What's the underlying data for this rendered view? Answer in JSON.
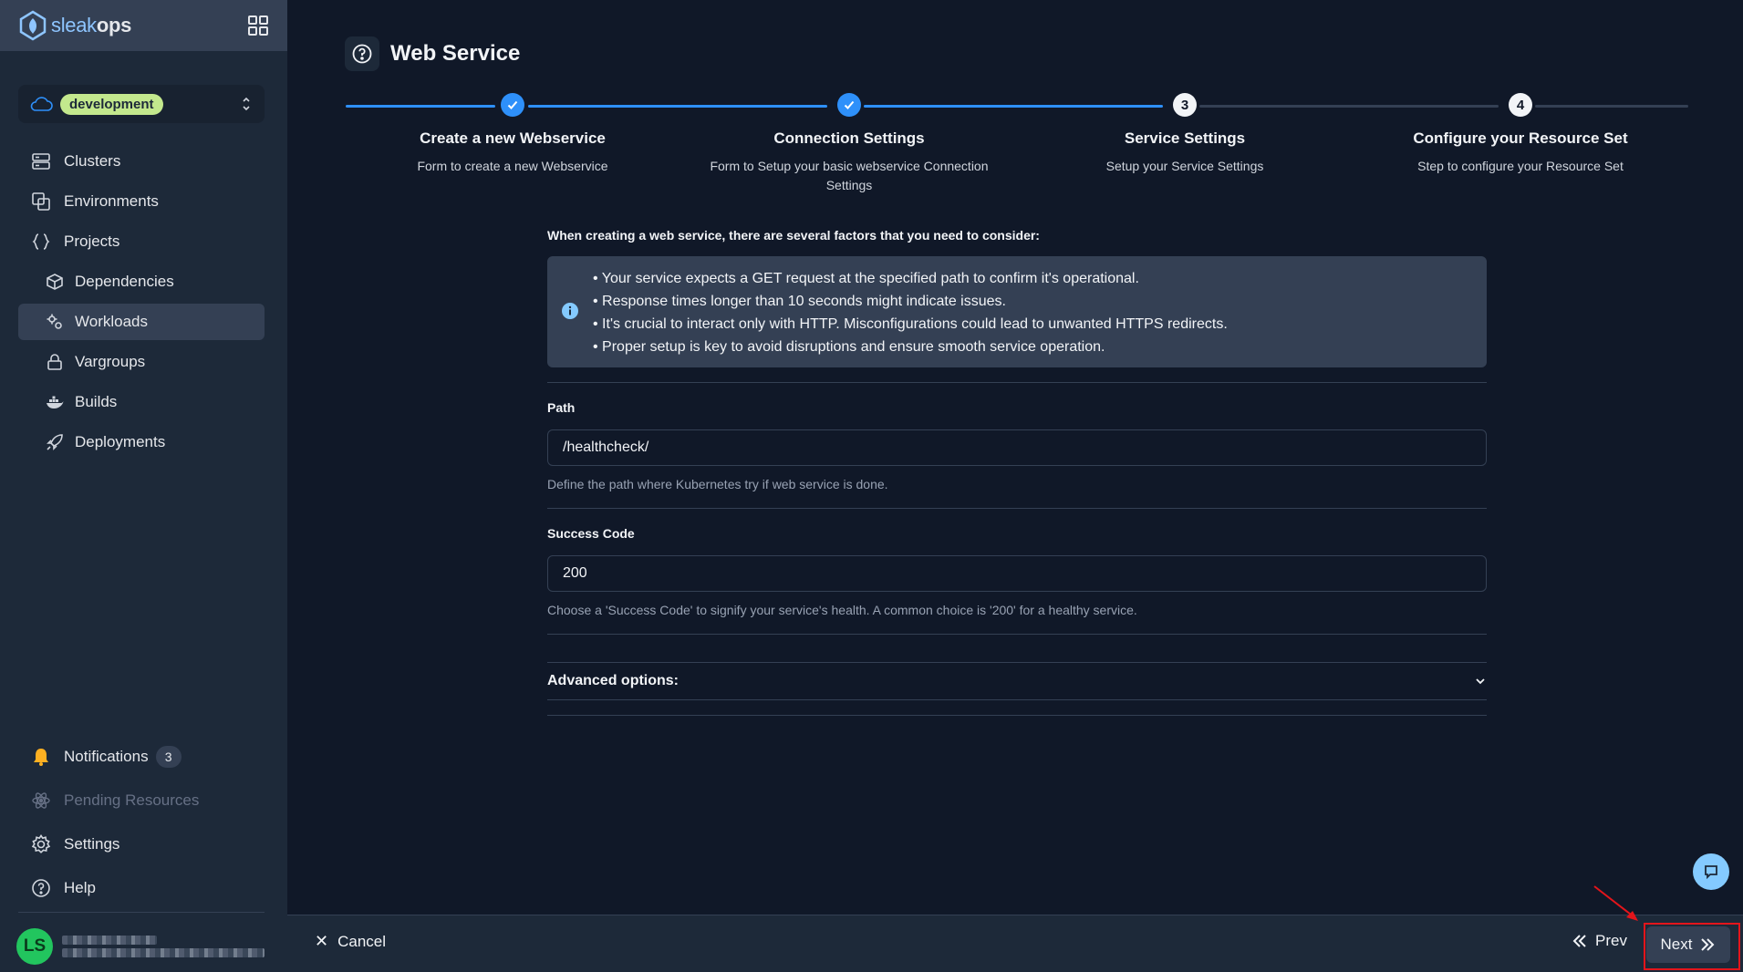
{
  "brand": {
    "prefix": "sleak",
    "suffix": "ops"
  },
  "environment": {
    "label": "development"
  },
  "nav": {
    "clusters": "Clusters",
    "environments": "Environments",
    "projects": "Projects",
    "dependencies": "Dependencies",
    "workloads": "Workloads",
    "vargroups": "Vargroups",
    "builds": "Builds",
    "deployments": "Deployments"
  },
  "bottom_nav": {
    "notifications": "Notifications",
    "notifications_count": "3",
    "pending": "Pending Resources",
    "settings": "Settings",
    "help": "Help"
  },
  "user": {
    "initials": "LS"
  },
  "page": {
    "title": "Web Service"
  },
  "steps": [
    {
      "number": "1",
      "title": "Create a new Webservice",
      "desc": "Form to create a new Webservice",
      "state": "done"
    },
    {
      "number": "2",
      "title": "Connection Settings",
      "desc": "Form to Setup your basic webservice Connection Settings",
      "state": "done"
    },
    {
      "number": "3",
      "title": "Service Settings",
      "desc": "Setup your Service Settings",
      "state": "current"
    },
    {
      "number": "4",
      "title": "Configure your Resource Set",
      "desc": "Step to configure your Resource Set",
      "state": "todo"
    }
  ],
  "form": {
    "consider": "When creating a web service, there are several factors that you need to consider:",
    "notes": [
      "Your service expects a GET request at the specified path to confirm it's operational.",
      "Response times longer than 10 seconds might indicate issues.",
      "It's crucial to interact only with HTTP. Misconfigurations could lead to unwanted HTTPS redirects.",
      "Proper setup is key to avoid disruptions and ensure smooth service operation."
    ],
    "path_label": "Path",
    "path_value": "/healthcheck/",
    "path_help": "Define the path where Kubernetes try if web service is done.",
    "code_label": "Success Code",
    "code_value": "200",
    "code_help": "Choose a 'Success Code' to signify your service's health. A common choice is '200' for a healthy service.",
    "advanced_label": "Advanced options:"
  },
  "footer": {
    "cancel": "Cancel",
    "prev": "Prev",
    "next": "Next"
  },
  "colors": {
    "accent": "#2e90fa",
    "env_badge": "#c3e88d",
    "avatar": "#22c55e",
    "annotation": "#e3151b"
  }
}
